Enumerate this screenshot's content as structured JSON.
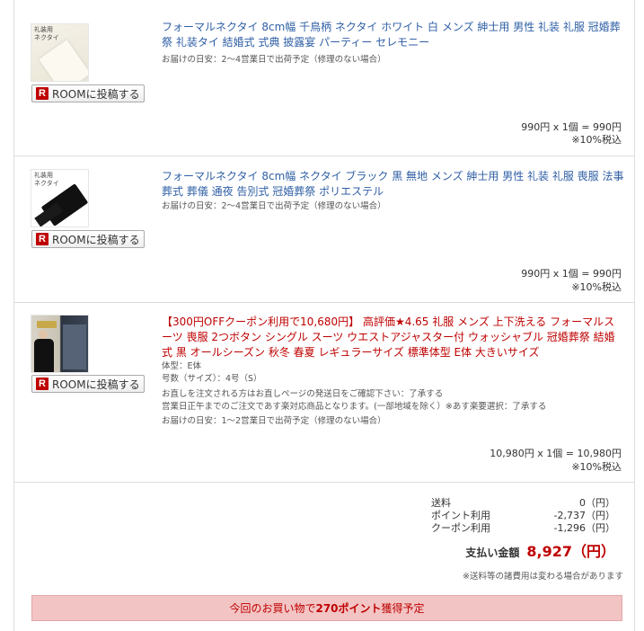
{
  "items": [
    {
      "thumb_text": "礼装用\nネクタイ",
      "room_label": "ROOMに投稿する",
      "title": "フォーマルネクタイ 8cm幅 千鳥柄 ネクタイ ホワイト 白 メンズ 紳士用 男性 礼装 礼服 冠婚葬祭 礼装タイ 結婚式 式典 披露宴 パーティー セレモニー",
      "meta": [
        "お届けの日安：2〜4営業日で出荷予定（修理のない場合）"
      ],
      "price_line": "990円 x 1個 = 990円",
      "tax_line": "※10%税込"
    },
    {
      "thumb_text": "礼装用\nネクタイ",
      "room_label": "ROOMに投稿する",
      "title": "フォーマルネクタイ 8cm幅 ネクタイ ブラック 黒 無地 メンズ 紳士用 男性 礼装 礼服 喪服 法事 葬式 葬儀 通夜 告別式 冠婚葬祭 ポリエステル",
      "meta": [
        "お届けの日安：2〜4営業日で出荷予定（修理のない場合）"
      ],
      "price_line": "990円 x 1個 = 990円",
      "tax_line": "※10%税込"
    },
    {
      "room_label": "ROOMに投稿する",
      "title": "【300円OFFクーポン利用で10,680円】 高評価★4.65 礼服 メンズ 上下洗える フォーマルスーツ 喪服 2つボタン シングル スーツ ウエストアジャスター付 ウォッシャブル 冠婚葬祭 結婚式 黒 オールシーズン 秋冬 春夏 レギュラーサイズ 標準体型 E体 大きいサイズ",
      "meta": [
        "体型：E体",
        "号数（サイズ）：4号（S）",
        "お直しを注文される方はお直しページの発送日をご確認下さい：了承する",
        "営業日正午までのご注文であす楽対応商品となります。(一部地域を除く）※あす楽要選択：了承する",
        "お届けの日安：1〜2営業日で出荷予定（修理のない場合）"
      ],
      "price_line": "10,980円 x 1個 = 10,980円",
      "tax_line": "※10%税込"
    }
  ],
  "summary": {
    "rows": [
      {
        "label": "送料",
        "value": "0（円）"
      },
      {
        "label": "ポイント利用",
        "value": "-2,737（円）"
      },
      {
        "label": "クーポン利用",
        "value": "-1,296（円）"
      }
    ],
    "total_label": "支払い金額",
    "total_value": "8,927（円）",
    "note": "※送料等の諸費用は変わる場合があります"
  },
  "points_banner": {
    "prefix": "今回のお買い物で",
    "points": "270ポイント",
    "suffix": "獲得予定"
  },
  "colors": {
    "link_blue": "#2f5fa5",
    "accent_red": "#bf0000",
    "banner_bg": "#f2c4c4"
  }
}
